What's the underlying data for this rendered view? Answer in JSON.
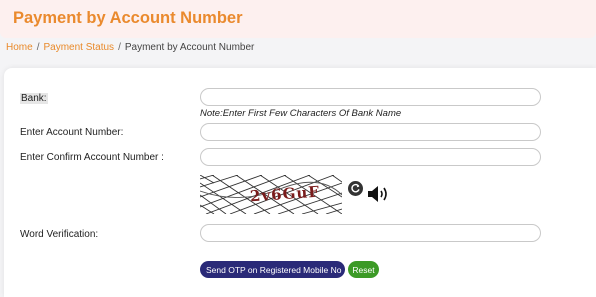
{
  "header": {
    "title": "Payment by Account Number"
  },
  "breadcrumb": {
    "items": [
      "Home",
      "Payment Status",
      "Payment by Account Number"
    ],
    "separator": "/"
  },
  "form": {
    "bank_label": "Bank:",
    "bank_value": "",
    "bank_note": "Note:Enter First Few Characters Of Bank Name",
    "account_label": "Enter Account Number:",
    "account_value": "",
    "confirm_label": "Enter Confirm Account Number :",
    "confirm_value": "",
    "captcha_text": "2v6GuF",
    "word_label": "Word Verification:",
    "word_value": "",
    "otp_button": "Send OTP on Registered Mobile No",
    "reset_button": "Reset"
  },
  "icons": {
    "refresh": "refresh-icon",
    "speaker": "speaker-icon"
  },
  "colors": {
    "title": "#ea8a2e",
    "title_band": "#fdf0ef",
    "link": "#e98a2a",
    "otp_button": "#2a2a78",
    "reset_button": "#3c9a26",
    "captcha_text": "#7a1b1b"
  }
}
